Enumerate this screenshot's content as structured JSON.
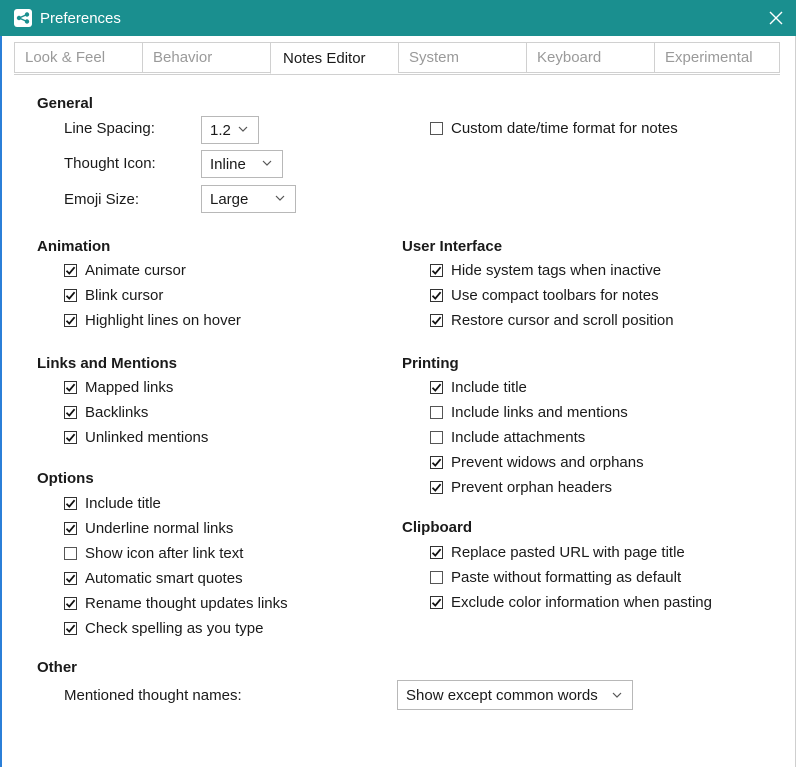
{
  "window": {
    "title": "Preferences"
  },
  "tabs": [
    "Look & Feel",
    "Behavior",
    "Notes Editor",
    "System",
    "Keyboard",
    "Experimental"
  ],
  "general": {
    "title": "General",
    "line_spacing_label": "Line Spacing:",
    "line_spacing_value": "1.2",
    "thought_icon_label": "Thought Icon:",
    "thought_icon_value": "Inline",
    "emoji_size_label": "Emoji Size:",
    "emoji_size_value": "Large",
    "custom_date_label": "Custom date/time format for notes"
  },
  "animation": {
    "title": "Animation",
    "items": [
      {
        "label": "Animate cursor",
        "checked": true
      },
      {
        "label": "Blink cursor",
        "checked": true
      },
      {
        "label": "Highlight lines on hover",
        "checked": true
      }
    ]
  },
  "links": {
    "title": "Links and Mentions",
    "items": [
      {
        "label": "Mapped links",
        "checked": true
      },
      {
        "label": "Backlinks",
        "checked": true
      },
      {
        "label": "Unlinked mentions",
        "checked": true
      }
    ]
  },
  "options": {
    "title": "Options",
    "items": [
      {
        "label": "Include title",
        "checked": true
      },
      {
        "label": "Underline normal links",
        "checked": true
      },
      {
        "label": "Show icon after link text",
        "checked": false
      },
      {
        "label": "Automatic smart quotes",
        "checked": true
      },
      {
        "label": "Rename thought updates links",
        "checked": true
      },
      {
        "label": "Check spelling as you type",
        "checked": true
      }
    ]
  },
  "ui": {
    "title": "User Interface",
    "items": [
      {
        "label": "Hide system tags when inactive",
        "checked": true
      },
      {
        "label": "Use compact toolbars for notes",
        "checked": true
      },
      {
        "label": "Restore cursor and scroll position",
        "checked": true
      }
    ]
  },
  "printing": {
    "title": "Printing",
    "items": [
      {
        "label": "Include title",
        "checked": true
      },
      {
        "label": "Include links and mentions",
        "checked": false
      },
      {
        "label": "Include attachments",
        "checked": false
      },
      {
        "label": "Prevent widows and orphans",
        "checked": true
      },
      {
        "label": "Prevent orphan headers",
        "checked": true
      }
    ]
  },
  "clipboard": {
    "title": "Clipboard",
    "items": [
      {
        "label": "Replace pasted URL with page title",
        "checked": true
      },
      {
        "label": "Paste without formatting as default",
        "checked": false
      },
      {
        "label": "Exclude color information when pasting",
        "checked": true
      }
    ]
  },
  "other": {
    "title": "Other",
    "mentioned_label": "Mentioned thought names:",
    "mentioned_value": "Show except common words"
  },
  "colors": {
    "titlebar": "#1a8f8f",
    "frame_accent": "#2b7fd8"
  }
}
